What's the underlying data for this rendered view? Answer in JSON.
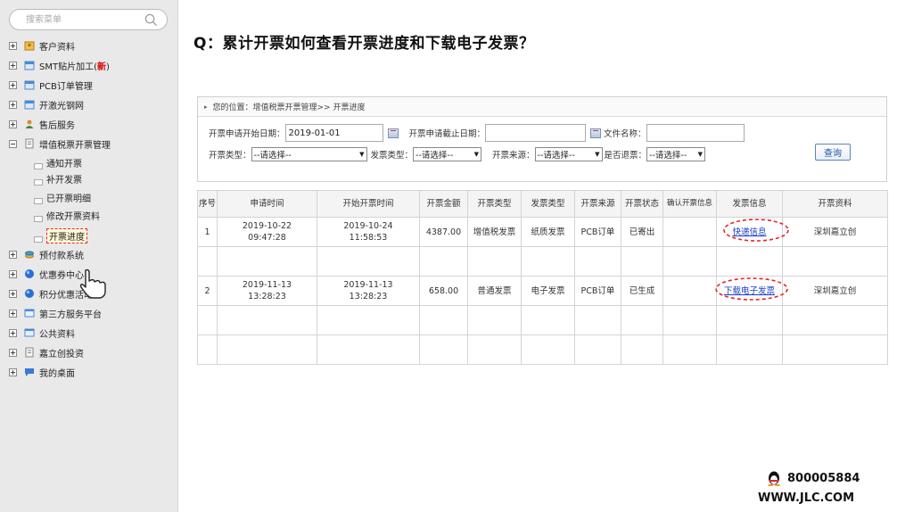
{
  "sidebar": {
    "search_placeholder": "搜索菜单",
    "items": [
      {
        "label": "客户资料",
        "icon": "contact-card-icon",
        "color": "#d88a2a"
      },
      {
        "label": "SMT贴片加工(",
        "new_badge": "新",
        "suffix": ")",
        "icon": "calendar-icon",
        "color": "#4a8ad4"
      },
      {
        "label": "PCB订单管理",
        "icon": "calendar-icon",
        "color": "#4a8ad4"
      },
      {
        "label": "开激光钢网",
        "icon": "calendar-icon",
        "color": "#4a8ad4"
      },
      {
        "label": "售后服务",
        "icon": "people-icon",
        "color": "#e08a2a"
      },
      {
        "label": "增值税票开票管理",
        "icon": "document-icon",
        "color": "#888"
      },
      {
        "label": "预付款系统",
        "icon": "coins-icon",
        "color": "#3aa0d8"
      },
      {
        "label": "优惠券中心",
        "icon": "globe-icon",
        "color": "#2a6fd4"
      },
      {
        "label": "积分优惠活动",
        "icon": "globe-icon",
        "color": "#2a6fd4"
      },
      {
        "label": "第三方服务平台",
        "icon": "window-icon",
        "color": "#4a8ad4"
      },
      {
        "label": "公共资料",
        "icon": "window-icon",
        "color": "#4a8ad4"
      },
      {
        "label": "嘉立创投资",
        "icon": "document-icon",
        "color": "#888"
      },
      {
        "label": "我的桌面",
        "icon": "chat-bubble-icon",
        "color": "#3a7ad4"
      }
    ],
    "sub_items": [
      "通知开票",
      "补开发票",
      "已开票明细",
      "修改开票资料",
      "开票进度"
    ]
  },
  "page_title": "Q：累计开票如何查看开票进度和下载电子发票？",
  "breadcrumb": "您的位置：增值税票开票管理>> 开票进度",
  "form": {
    "start_date_label": "开票申请开始日期：",
    "start_date_value": "2019-01-01",
    "end_date_label": "开票申请截止日期：",
    "end_date_value": "",
    "filename_label": "文件名称：",
    "filename_value": "",
    "invoice_type_label": "开票类型：",
    "invoice_type_value": "--请选择--",
    "fapiao_type_label": "发票类型：",
    "fapiao_type_value": "--请选择--",
    "source_label": "开票来源：",
    "source_value": "--请选择--",
    "refund_label": "是否退票：",
    "refund_value": "--请选择--",
    "query_button": "查询"
  },
  "table": {
    "headers": [
      "序号",
      "申请时间",
      "开始开票时间",
      "开票金额",
      "开票类型",
      "发票类型",
      "开票来源",
      "开票状态",
      "确认开票信息",
      "发票信息",
      "开票资料"
    ],
    "rows": [
      {
        "no": "1",
        "apply_date": "2019-10-22",
        "apply_time": "09:47:28",
        "start_date": "2019-10-24",
        "start_time": "11:58:53",
        "amount": "4387.00",
        "invoice_type": "增值税发票",
        "fapiao_type": "纸质发票",
        "source": "PCB订单",
        "status": "已寄出",
        "confirm": "",
        "info": "快递信息",
        "data": "深圳嘉立创"
      },
      {
        "no": "2",
        "apply_date": "2019-11-13",
        "apply_time": "13:28:23",
        "start_date": "2019-11-13",
        "start_time": "13:28:23",
        "amount": "658.00",
        "invoice_type": "普通发票",
        "fapiao_type": "电子发票",
        "source": "PCB订单",
        "status": "已生成",
        "confirm": "",
        "info": "下载电子发票",
        "data": "深圳嘉立创"
      }
    ]
  },
  "footer": {
    "qq_number": "800005884",
    "website": "WWW.JLC.COM"
  }
}
